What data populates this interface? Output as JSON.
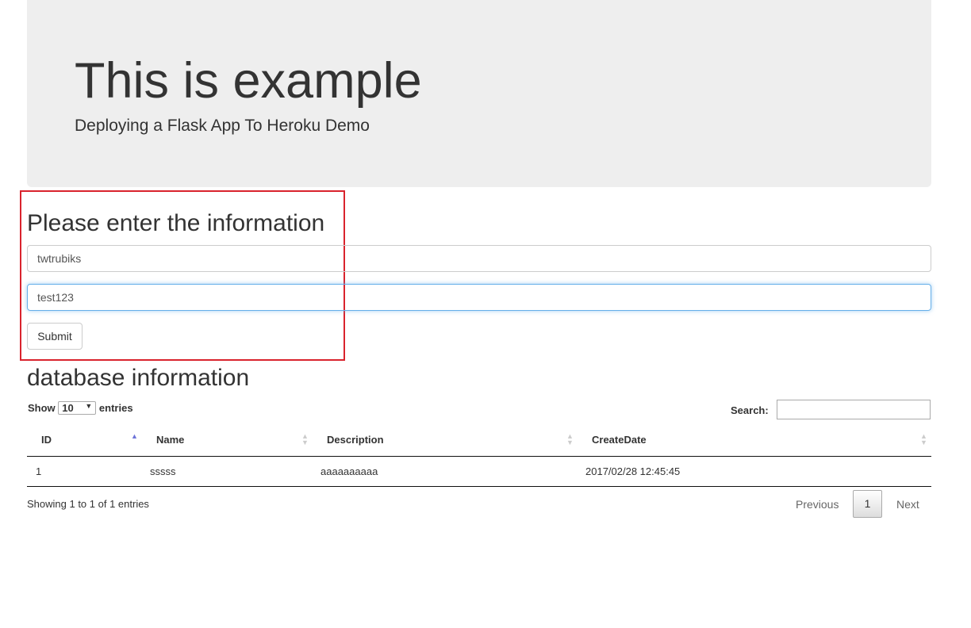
{
  "header": {
    "title": "This is example",
    "subtitle": "Deploying a Flask App To Heroku Demo"
  },
  "form": {
    "heading": "Please enter the information",
    "username": "twtrubiks",
    "password": "test123",
    "submit": "Submit"
  },
  "db": {
    "heading": "database information",
    "show": "Show",
    "length": "10",
    "entries": "entries",
    "search_label": "Search:",
    "columns": [
      "ID",
      "Name",
      "Description",
      "CreateDate"
    ],
    "rows": [
      [
        "1",
        "sssss",
        "aaaaaaaaaa",
        "2017/02/28 12:45:45"
      ]
    ],
    "info": "Showing 1 to 1 of 1 entries",
    "prev": "Previous",
    "page": "1",
    "next": "Next"
  },
  "colors": {
    "highlight_box": "#d9232d",
    "jumbotron": "#eeeeee",
    "sort_active": "#6d73d8"
  }
}
